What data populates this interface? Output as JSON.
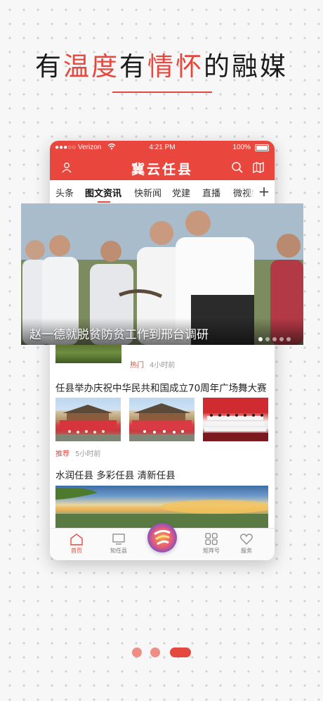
{
  "headline": {
    "part1": "有",
    "part2": "温度",
    "part3": "有",
    "part4": "情怀",
    "part5": "的融媒"
  },
  "status_bar": {
    "carrier": "●●●○○ Verizon",
    "time": "4:21 PM",
    "battery": "100%"
  },
  "app_bar": {
    "title": "冀云任县",
    "icons": [
      "user-icon",
      "search-icon",
      "map-icon"
    ]
  },
  "tabs": [
    "头条",
    "图文资讯",
    "快新闻",
    "党建",
    "直播",
    "微视频"
  ],
  "active_tab": "图文资讯",
  "hero": {
    "title": "赵一德就脱贫防贫工作到邢台调研",
    "slide_count": 5,
    "active_slide": 1
  },
  "feed": [
    {
      "tag": "热门",
      "time": "4小时前"
    },
    {
      "title": "任县举办庆祝中华民共和国成立70周年广场舞大赛",
      "tag": "推荐",
      "time": "5小时前"
    },
    {
      "title": "水润任县  多彩任县  清新任县"
    }
  ],
  "bottom_nav": [
    {
      "label": "首页",
      "icon": "home-icon",
      "active": true
    },
    {
      "label": "知任县",
      "icon": "monitor-icon",
      "active": false
    },
    {
      "label": "",
      "icon": "app-logo-icon",
      "active": false
    },
    {
      "label": "矩阵号",
      "icon": "grid-icon",
      "active": false
    },
    {
      "label": "服务",
      "icon": "heart-icon",
      "active": false
    }
  ],
  "pager": {
    "count": 3,
    "active": 3
  },
  "colors": {
    "brand_red": "#e9473d",
    "accent_red": "#e4483e"
  }
}
